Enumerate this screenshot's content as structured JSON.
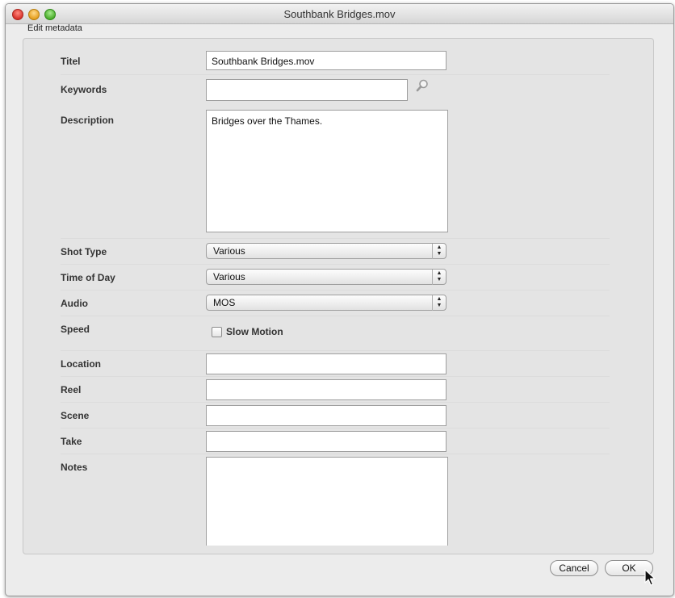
{
  "window": {
    "title": "Southbank Bridges.mov",
    "section": "Edit metadata"
  },
  "form": {
    "titel": {
      "label": "Titel",
      "value": "Southbank Bridges.mov"
    },
    "keywords": {
      "label": "Keywords",
      "value": ""
    },
    "description": {
      "label": "Description",
      "value": "Bridges over the Thames."
    },
    "shot_type": {
      "label": "Shot Type",
      "value": "Various"
    },
    "time_of_day": {
      "label": "Time of Day",
      "value": "Various"
    },
    "audio": {
      "label": "Audio",
      "value": "MOS"
    },
    "speed": {
      "label": "Speed",
      "checkbox_label": "Slow Motion",
      "checked": false
    },
    "location": {
      "label": "Location",
      "value": ""
    },
    "reel": {
      "label": "Reel",
      "value": ""
    },
    "scene": {
      "label": "Scene",
      "value": ""
    },
    "take": {
      "label": "Take",
      "value": ""
    },
    "notes": {
      "label": "Notes",
      "value": ""
    }
  },
  "buttons": {
    "cancel": "Cancel",
    "ok": "OK"
  },
  "icons": {
    "search": "magnifier-icon",
    "popup_arrows": "up-down-arrows-icon",
    "cursor": "mouse-pointer-icon"
  }
}
